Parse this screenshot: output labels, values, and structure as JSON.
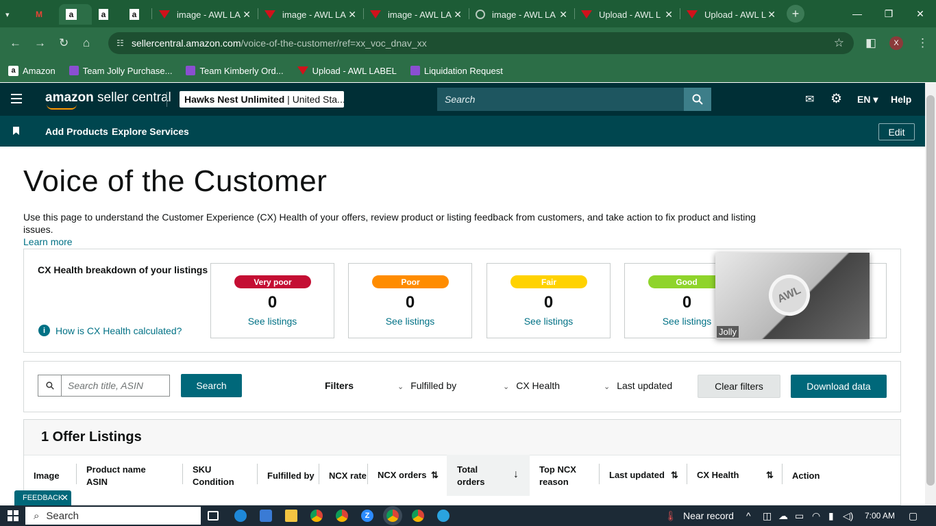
{
  "browser": {
    "tabs": [
      {
        "title": "",
        "icon": "gmail-icon"
      },
      {
        "title": "",
        "icon": "amazon-icon",
        "active": true
      },
      {
        "title": "",
        "icon": "amazon-icon"
      },
      {
        "title": "",
        "icon": "amazon-icon"
      },
      {
        "title": "image - AWL LA",
        "icon": "awl-icon"
      },
      {
        "title": "image - AWL LA",
        "icon": "awl-icon"
      },
      {
        "title": "image - AWL LA",
        "icon": "awl-icon"
      },
      {
        "title": "image - AWL LA",
        "icon": "loading-icon"
      },
      {
        "title": "Upload - AWL L",
        "icon": "awl-icon"
      },
      {
        "title": "Upload - AWL L",
        "icon": "awl-icon"
      }
    ],
    "url_domain": "sellercentral.amazon.com",
    "url_path": "/voice-of-the-customer/ref=xx_voc_dnav_xx",
    "profile_initial": "X",
    "bookmarks": [
      "Amazon",
      "Team Jolly Purchase...",
      "Team Kimberly Ord...",
      "Upload - AWL LABEL",
      "Liquidation Request"
    ]
  },
  "header": {
    "logo_amazon": "amazon",
    "logo_rest": "seller central",
    "store_name": "Hawks Nest Unlimited",
    "store_region": "United Sta...",
    "search_placeholder": "Search",
    "language": "EN",
    "help": "Help"
  },
  "subnav": {
    "links": [
      "Add Products",
      "Explore Services"
    ],
    "edit": "Edit"
  },
  "page": {
    "title": "Voice of the Customer",
    "description": "Use this page to understand the Customer Experience (CX) Health of your offers, review product or listing feedback from customers, and take action to fix product and listing issues.",
    "learn_more": "Learn more"
  },
  "cx_health": {
    "title": "CX Health breakdown of your listings",
    "how_link": "How is CX Health calculated?",
    "boxes": [
      {
        "label": "Very poor",
        "count": "0",
        "link": "See listings",
        "color": "#c40e33",
        "text": "#ffffff"
      },
      {
        "label": "Poor",
        "count": "0",
        "link": "See listings",
        "color": "#ff8c00",
        "text": "#ffffff"
      },
      {
        "label": "Fair",
        "count": "0",
        "link": "See listings",
        "color": "#ffd200",
        "text": "#ffffff"
      },
      {
        "label": "Good",
        "count": "0",
        "link": "See listings",
        "color": "#8fd42b",
        "text": "#ffffff"
      }
    ]
  },
  "popup": {
    "caption": "Jolly",
    "logo_text": "AWL"
  },
  "filters": {
    "search_placeholder": "Search title, ASIN",
    "search_button": "Search",
    "label": "Filters",
    "dropdowns": [
      "Fulfilled by",
      "CX Health",
      "Last updated"
    ],
    "clear": "Clear filters",
    "download": "Download data"
  },
  "table": {
    "heading": "1 Offer Listings",
    "columns": [
      "Image",
      "Product name\nASIN",
      "SKU\nCondition",
      "Fulfilled by",
      "NCX rate",
      "NCX orders",
      "Total\norders",
      "Top NCX\nreason",
      "Last updated",
      "CX Health",
      "Action"
    ]
  },
  "feedback": "FEEDBACK",
  "taskbar": {
    "search": "Search",
    "weather": "Near record",
    "time": "7:00 AM"
  }
}
